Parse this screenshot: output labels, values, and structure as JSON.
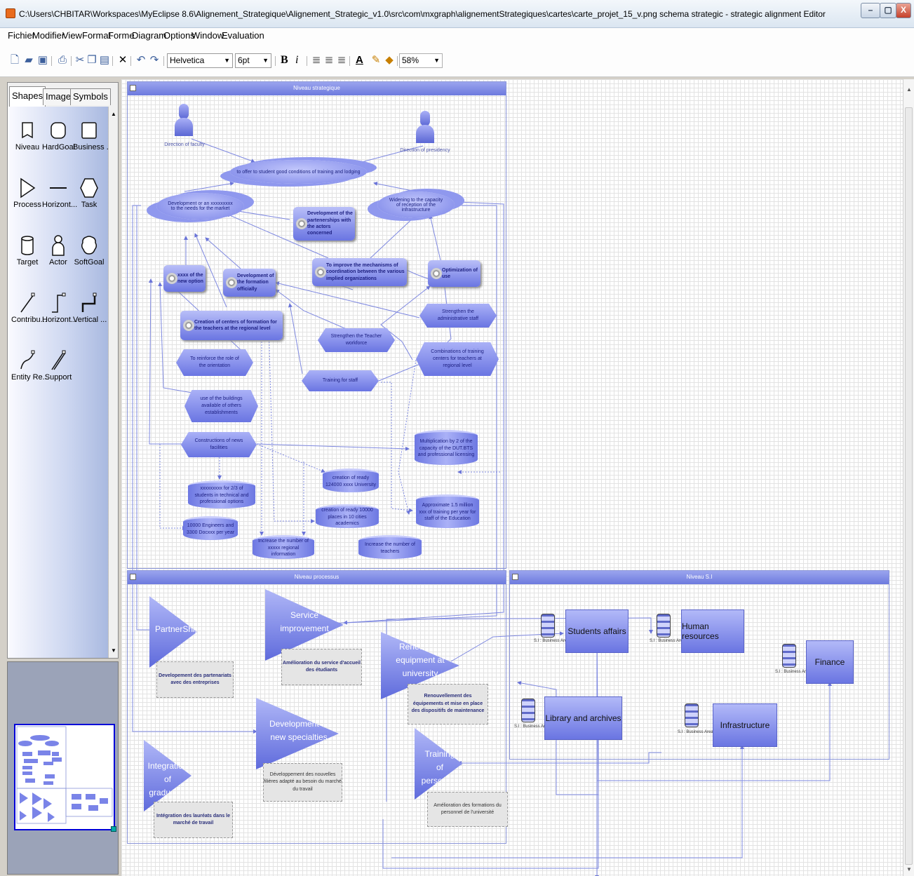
{
  "window": {
    "title": "C:\\Users\\CHBITAR\\Workspaces\\MyEclipse 8.6\\Alignement_Strategique\\Alignement_Strategic_v1.0\\src\\com\\mxgraph\\alignementStrategiques\\cartes\\carte_projet_15_v.png schema strategic - strategic alignment Editor",
    "controls": {
      "minimize": "–",
      "maximize": "▢",
      "close": "X"
    }
  },
  "menu": [
    "Fichier",
    "Modifier",
    "View",
    "Format",
    "Forme",
    "Diagram",
    "Options",
    "Window",
    "Evaluation"
  ],
  "toolbar": {
    "font": "Helvetica",
    "size": "6pt",
    "zoom": "58%",
    "bold": "B",
    "italic": "i",
    "font_color_label": "A"
  },
  "palette": {
    "tabs": [
      "Shapes",
      "Images",
      "Symbols"
    ],
    "items": [
      {
        "label": "Niveau",
        "icon": "level-icon"
      },
      {
        "label": "HardGoal",
        "icon": "hardgoal-icon"
      },
      {
        "label": "Business ...",
        "icon": "business-icon"
      },
      {
        "label": "Process",
        "icon": "process-icon"
      },
      {
        "label": "Horizont...",
        "icon": "horizontal-line-icon"
      },
      {
        "label": "Task",
        "icon": "task-icon"
      },
      {
        "label": "Target",
        "icon": "target-icon"
      },
      {
        "label": "Actor",
        "icon": "actor-icon"
      },
      {
        "label": "SoftGoal",
        "icon": "softgoal-icon"
      },
      {
        "label": "Contribu...",
        "icon": "contribution-icon"
      },
      {
        "label": "Horizont...",
        "icon": "horizontal-connector-icon"
      },
      {
        "label": "Vertical ...",
        "icon": "vertical-connector-icon"
      },
      {
        "label": "Entity Re...",
        "icon": "entity-relation-icon"
      },
      {
        "label": "Support",
        "icon": "support-icon"
      }
    ]
  },
  "pools": {
    "strategic": "Niveau strategique",
    "process": "Niveau processus",
    "si": "Niveau S.I"
  },
  "actors": [
    "Direction of faculty",
    "Direction of presidency"
  ],
  "softgoals": {
    "main": "to offer to student good conditions of training and lodging",
    "left": "Development or an xxxxxxxxx to the needs for the market",
    "right": "Widening to the capacity of reception of the infrastructure"
  },
  "tasks": {
    "partnerships": "Development of the partenerships with the actors concerned",
    "mechanisms": "To improve the mechanisms of coordination between the various implied organizations",
    "optimization": "Optimization of use",
    "new_option": "xxxx of the new option",
    "formation": "Development of the formation officially",
    "centers": "Creation of centers of formation for the teachers at the regional level"
  },
  "targets": {
    "admin_staff": "Strengthen the administrative staff",
    "teacher_workforce": "Strengthen the Teacher workforce",
    "combinations": "Combinations of training centers for teachers at regional level",
    "orientation": "To reinforce the role of the orientation",
    "training_staff": "Training for staff",
    "buildings": "use of the buildings available of others establishments",
    "constructions": "Constructions of news facilities"
  },
  "indicators": {
    "multiplication": "Multiplication by 2 of the capacity of the DUT.BTS and professional licensing",
    "creation_124000": "creation of ready 124000 xxxx University",
    "students": "xxxxxxxxx for 2/3 of students in technical and professional options",
    "creation_10000": "creation of ready 10000 places in 10 cities academics",
    "million": "Approximate 1.5 million xxx of training per year for staff of the Education",
    "engineers": "10000 Engineers and 3300 Docxxx per year",
    "regional": "Increase the number of xxxxx regional information",
    "teachers": "Increase the number of teachers"
  },
  "processes": {
    "partnership": "PartnerShip",
    "service": "Service improvement",
    "renewal": "Renewel of equipment at university",
    "specialties": "Development of new specialties",
    "integration": "Integration of graduates",
    "training": "Training of personnel"
  },
  "notes": {
    "partnership": "Developement des partenariats avec des entreprises",
    "service": "Amélioration du service d'accueil des étudiants",
    "renewal": "Renouvellement des équipements et mise en place des dispositifs de maintenance",
    "specialties": "Développement des nouvelles filières adapté au besoin du marché du travail",
    "integration": "Intégration des lauréats dans le marché de travail",
    "training": "Amélioration des formations du personnel de l'université"
  },
  "si": {
    "students": "Students affairs",
    "hr": "Human resources",
    "finance": "Finance",
    "library": "Library and archives",
    "infrastructure": "Infrastructure",
    "area_label": "S.I : Business Area"
  }
}
